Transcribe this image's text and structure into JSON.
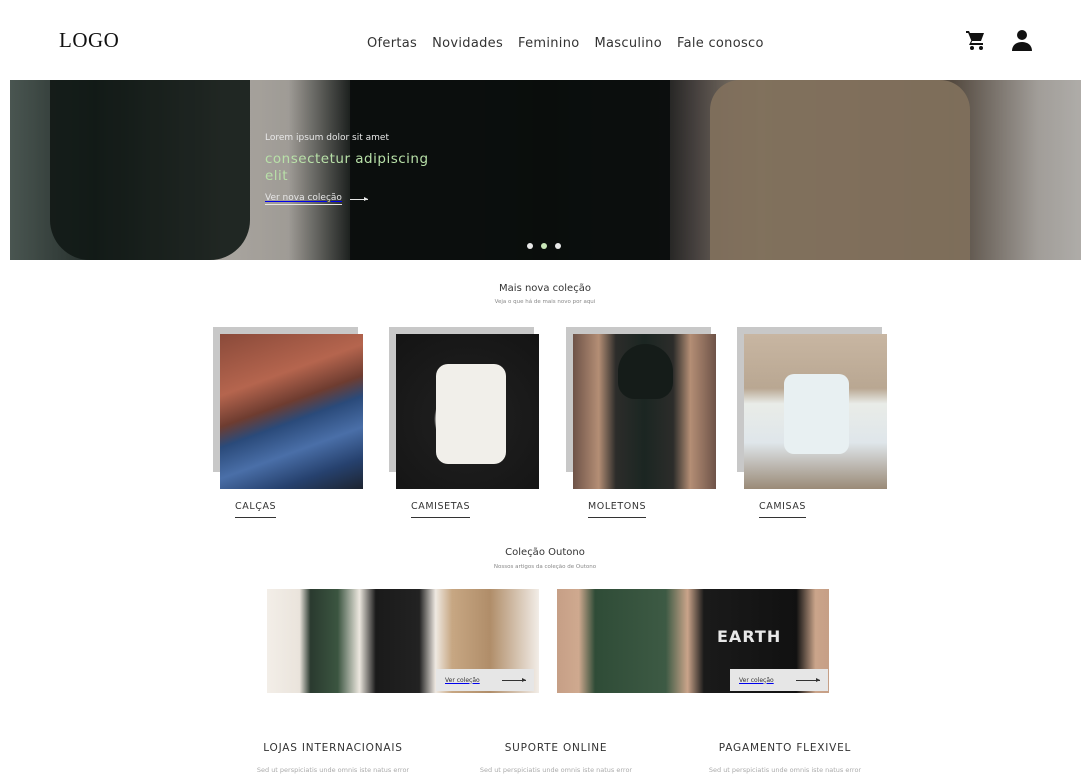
{
  "header": {
    "logo": "LOGO",
    "nav": [
      "Ofertas",
      "Novidades",
      "Feminino",
      "Masculino",
      "Fale conosco"
    ],
    "icons": [
      "cart-icon",
      "user-icon"
    ]
  },
  "hero": {
    "kicker": "Lorem ipsum dolor sit amet",
    "title": "consectetur adipiscing elit",
    "link_label": "Ver nova coleção",
    "slides": 3,
    "active_slide": 2,
    "accent_color": "#b8e0a8"
  },
  "new_collection": {
    "title": "Mais nova coleção",
    "subtitle": "Veja o que há de mais novo por aqui",
    "categories": [
      "CALÇAS",
      "CAMISETAS",
      "MOLETONS",
      "CAMISAS"
    ]
  },
  "autumn": {
    "title": "Coleção Outono",
    "subtitle": "Nossos artigos da coleção de Outono",
    "banners": [
      {
        "button": "Ver coleção"
      },
      {
        "button": "Ver coleção",
        "print_text": "EARTH"
      }
    ]
  },
  "features": [
    {
      "title": "LOJAS INTERNACIONAIS",
      "text": "Sed ut perspiciatis unde omnis iste natus error"
    },
    {
      "title": "SUPORTE ONLINE",
      "text": "Sed ut perspiciatis unde omnis iste natus error"
    },
    {
      "title": "PAGAMENTO FLEXIVEL",
      "text": "Sed ut perspiciatis unde omnis iste natus error"
    }
  ]
}
